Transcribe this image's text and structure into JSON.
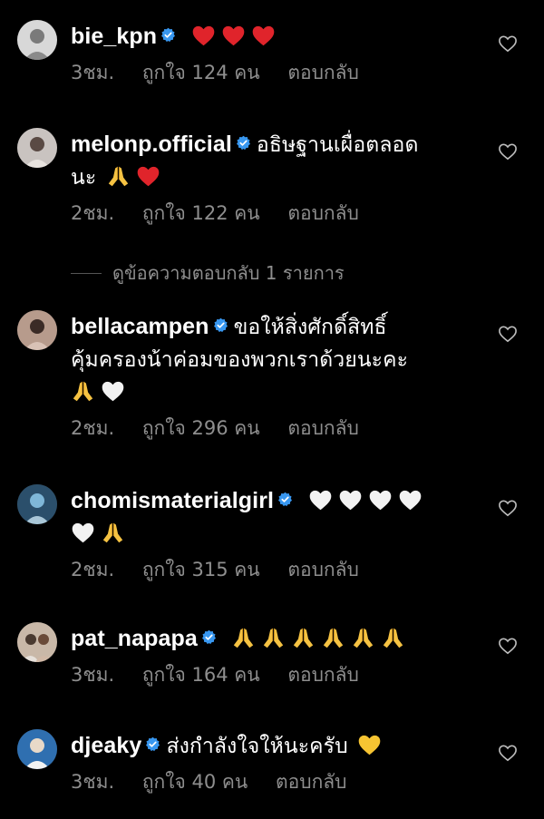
{
  "comments": [
    {
      "username": "bie_kpn",
      "verified": true,
      "text": "",
      "emojis": [
        "red-heart",
        "red-heart",
        "red-heart"
      ],
      "time": "3ชม.",
      "likes": "ถูกใจ 124 คน",
      "reply": "ตอบกลับ"
    },
    {
      "username": "melonp.official",
      "verified": true,
      "text_line1": "อธิษฐานเผื่อตลอด",
      "text_line2": "นะ",
      "emojis": [
        "folded-hands",
        "red-heart"
      ],
      "time": "2ชม.",
      "likes": "ถูกใจ 122 คน",
      "reply": "ตอบกลับ"
    },
    {
      "username": "bellacampen",
      "verified": true,
      "text_line1": "ขอให้สิ่งศักดิ์สิทธิ์",
      "text_line2": "คุ้มครองน้าค่อมของพวกเราด้วยนะคะ",
      "emojis": [
        "folded-hands",
        "white-heart"
      ],
      "time": "2ชม.",
      "likes": "ถูกใจ 296 คน",
      "reply": "ตอบกลับ"
    },
    {
      "username": "chomismaterialgirl",
      "verified": true,
      "emojis": [
        "white-heart",
        "white-heart",
        "white-heart",
        "white-heart",
        "white-heart",
        "folded-hands"
      ],
      "time": "2ชม.",
      "likes": "ถูกใจ 315 คน",
      "reply": "ตอบกลับ"
    },
    {
      "username": "pat_napapa",
      "verified": true,
      "emojis": [
        "folded-hands",
        "folded-hands",
        "folded-hands",
        "folded-hands",
        "folded-hands",
        "folded-hands"
      ],
      "time": "3ชม.",
      "likes": "ถูกใจ 164 คน",
      "reply": "ตอบกลับ"
    },
    {
      "username": "djeaky",
      "verified": true,
      "text": "ส่งกำลังใจให้นะครับ",
      "emojis": [
        "yellow-heart"
      ],
      "time": "3ชม.",
      "likes": "ถูกใจ 40 คน",
      "reply": "ตอบกลับ"
    }
  ],
  "view_replies": "ดูข้อความตอบกลับ 1 รายการ",
  "colors": {
    "background": "#000000",
    "meta": "#8e8e8e",
    "verified": "#3897f0",
    "red": "#e0242b"
  }
}
